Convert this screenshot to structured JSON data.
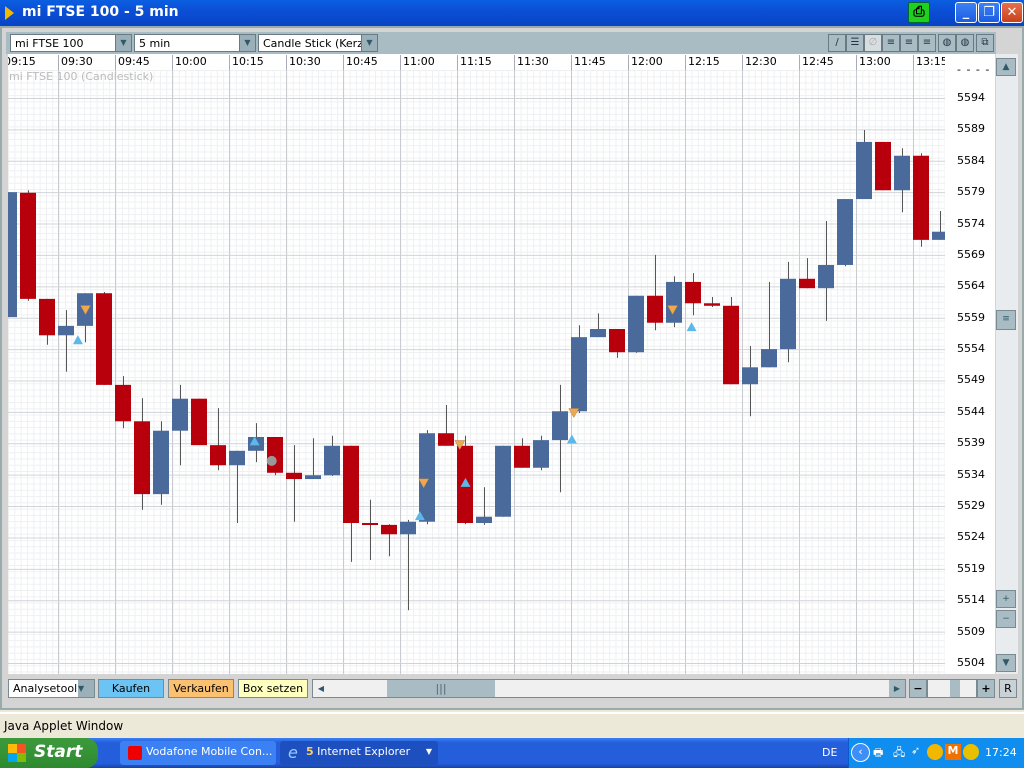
{
  "window": {
    "title": "mi FTSE 100 - 5 min",
    "print_icon": "printer-icon"
  },
  "toolbar": {
    "instrument": "mi FTSE 100",
    "interval": "5 min",
    "chart_type": "Candle Stick (Kerzen"
  },
  "chart": {
    "legend": "mi FTSE 100 (Candlestick)",
    "price_top_label": "- - - -"
  },
  "bottom": {
    "tool": "Analysetool",
    "buy": "Kaufen",
    "sell": "Verkaufen",
    "box": "Box setzen",
    "reset": "R",
    "minus": "−",
    "plus": "+"
  },
  "status": "Java Applet Window",
  "taskbar": {
    "start": "Start",
    "task1": "Vodafone Mobile Con...",
    "task2_count": "5",
    "task2": "Internet Explorer",
    "lang": "DE",
    "clock": "17:24"
  },
  "colors": {
    "up": "#4a6a9c",
    "down": "#b8000c",
    "buy": "#5bb8e8",
    "sell": "#f0a850"
  },
  "chart_data": {
    "type": "candlestick",
    "title": "mi FTSE 100 (Candlestick)",
    "time_ticks": [
      "09:15",
      "09:30",
      "09:45",
      "10:00",
      "10:15",
      "10:30",
      "10:45",
      "11:00",
      "11:15",
      "11:30",
      "11:45",
      "12:00",
      "12:15",
      "12:30",
      "12:45",
      "13:00",
      "13:15"
    ],
    "price_ticks": [
      5504,
      5509,
      5514,
      5519,
      5524,
      5529,
      5534,
      5539,
      5544,
      5549,
      5554,
      5559,
      5564,
      5569,
      5574,
      5579,
      5584,
      5589,
      5594
    ],
    "ylim": [
      5502.5,
      5600
    ],
    "ohlc": [
      [
        5559.1,
        5579,
        5559.1,
        5579
      ],
      [
        5578.9,
        5579.3,
        5561.7,
        5562
      ],
      [
        5562,
        5562,
        5554.7,
        5556.2
      ],
      [
        5556.2,
        5560.2,
        5550.4,
        5557.7
      ],
      [
        5557.7,
        5562.9,
        5555.1,
        5562.9
      ],
      [
        5562.9,
        5563.1,
        5548.3,
        5548.3
      ],
      [
        5548.3,
        5549.7,
        5541.4,
        5542.5
      ],
      [
        5542.5,
        5546.2,
        5528.4,
        5530.9
      ],
      [
        5530.9,
        5542.5,
        5529.2,
        5541
      ],
      [
        5541,
        5548.3,
        5535.5,
        5546.1
      ],
      [
        5546.1,
        5546.1,
        5538.7,
        5538.7
      ],
      [
        5538.7,
        5544.6,
        5534.7,
        5535.5
      ],
      [
        5535.5,
        5537.8,
        5526.3,
        5537.8
      ],
      [
        5537.8,
        5542.2,
        5536,
        5540
      ],
      [
        5540,
        5540,
        5533.9,
        5534.3
      ],
      [
        5534.3,
        5538.7,
        5526.5,
        5533.3
      ],
      [
        5533.3,
        5539.8,
        5533.3,
        5533.9
      ],
      [
        5533.9,
        5540.2,
        5533.8,
        5538.6
      ],
      [
        5538.6,
        5538.6,
        5520.1,
        5526.3
      ],
      [
        5526.3,
        5530,
        5520.4,
        5526
      ],
      [
        5526,
        5526.1,
        5521,
        5524.5
      ],
      [
        5524.5,
        5526.8,
        5512.4,
        5526.5
      ],
      [
        5526.5,
        5541.1,
        5526.1,
        5540.6
      ],
      [
        5540.6,
        5545.1,
        5538.6,
        5538.6
      ],
      [
        5538.6,
        5540.2,
        5526.1,
        5526.3
      ],
      [
        5526.3,
        5532,
        5526,
        5527.3
      ],
      [
        5527.3,
        5538.6,
        5527.3,
        5538.6
      ],
      [
        5538.6,
        5539.8,
        5535.1,
        5535.1
      ],
      [
        5535.1,
        5540.2,
        5534.7,
        5539.5
      ],
      [
        5539.5,
        5548.3,
        5531.2,
        5544.1
      ],
      [
        5544.1,
        5557.8,
        5543.8,
        5555.9
      ],
      [
        5555.9,
        5559.7,
        5555.9,
        5557.2
      ],
      [
        5557.2,
        5557.2,
        5552.6,
        5553.5
      ],
      [
        5553.5,
        5562.5,
        5553.4,
        5562.5
      ],
      [
        5562.5,
        5569,
        5557,
        5558.2
      ],
      [
        5558.2,
        5565.6,
        5557.5,
        5564.7
      ],
      [
        5564.7,
        5566.1,
        5559.4,
        5561.3
      ],
      [
        5561.3,
        5562.3,
        5560.7,
        5560.9
      ],
      [
        5560.9,
        5562.3,
        5548.4,
        5548.4
      ],
      [
        5548.4,
        5554.5,
        5543.3,
        5551.1
      ],
      [
        5551.1,
        5564.7,
        5551.1,
        5554
      ],
      [
        5554,
        5567.9,
        5551.9,
        5565.2
      ],
      [
        5565.2,
        5568.5,
        5563.7,
        5563.7
      ],
      [
        5563.7,
        5574.4,
        5558.5,
        5567.4
      ],
      [
        5567.4,
        5577.9,
        5567.2,
        5577.9
      ],
      [
        5577.9,
        5588.9,
        5577.9,
        5587
      ],
      [
        5587,
        5587,
        5579.3,
        5579.3
      ],
      [
        5579.3,
        5586,
        5575.8,
        5584.8
      ],
      [
        5584.8,
        5585.2,
        5570.3,
        5571.4
      ],
      [
        5571.4,
        5576,
        5571.4,
        5572.7
      ]
    ],
    "markers": [
      {
        "type": "buy",
        "index": 3.6,
        "price": 5555.4
      },
      {
        "type": "sell",
        "index": 4.0,
        "price": 5560.3
      },
      {
        "type": "buy",
        "index": 12.9,
        "price": 5539.3
      },
      {
        "type": "circle",
        "index": 13.8,
        "price": 5536.2
      },
      {
        "type": "buy",
        "index": 21.6,
        "price": 5527.4
      },
      {
        "type": "sell",
        "index": 21.8,
        "price": 5532.7
      },
      {
        "type": "sell",
        "index": 23.7,
        "price": 5538.8
      },
      {
        "type": "buy",
        "index": 24.0,
        "price": 5532.7
      },
      {
        "type": "buy",
        "index": 29.6,
        "price": 5539.6
      },
      {
        "type": "sell",
        "index": 29.7,
        "price": 5543.9
      },
      {
        "type": "sell",
        "index": 34.9,
        "price": 5560.3
      },
      {
        "type": "buy",
        "index": 35.9,
        "price": 5557.5
      }
    ]
  }
}
